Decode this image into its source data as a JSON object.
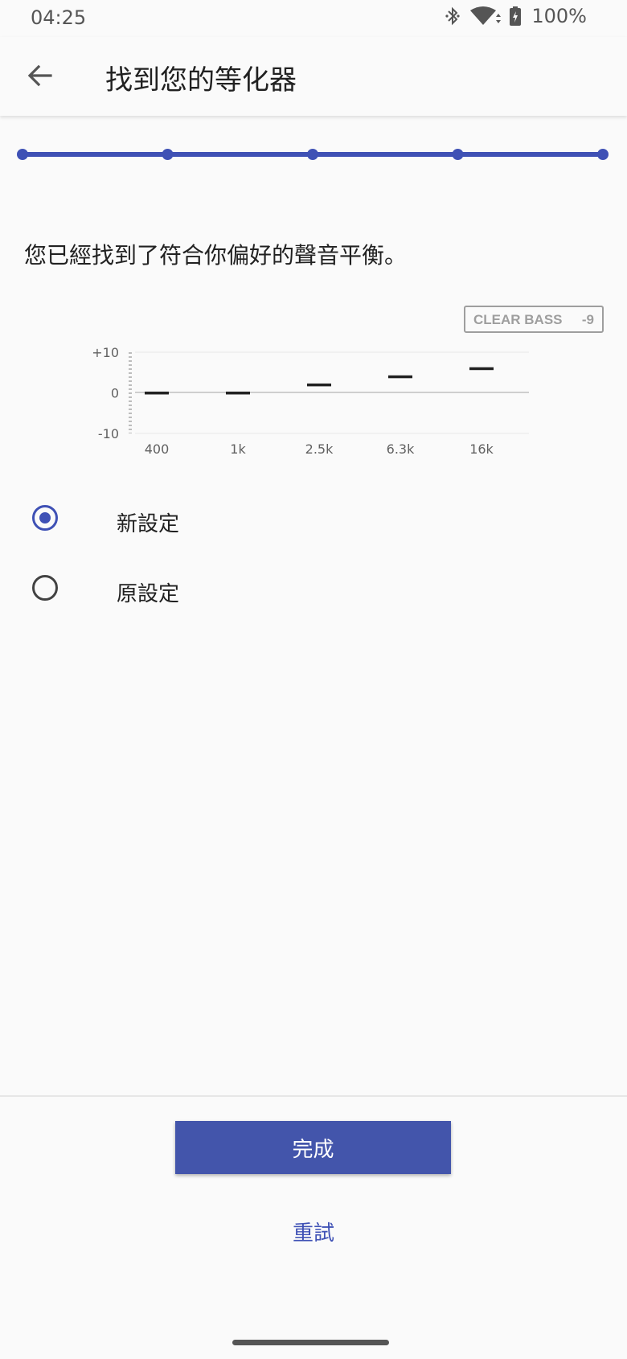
{
  "status_bar": {
    "time": "04:25",
    "battery": "100%",
    "icons": [
      "bluetooth-icon",
      "wifi-icon",
      "battery-charging-icon"
    ]
  },
  "app_bar": {
    "title": "找到您的等化器",
    "back_icon": "arrow-back-icon"
  },
  "progress": {
    "total_steps": 5,
    "completed_steps": 5,
    "accent": "#3f51b5"
  },
  "message": "您已經找到了符合你偏好的聲音平衡。",
  "clear_bass": {
    "label": "CLEAR BASS",
    "value": "-9"
  },
  "eq_chart": {
    "y_ticks": [
      "+10",
      "0",
      "-10"
    ],
    "ylim": [
      -10,
      10
    ],
    "bands": [
      "400",
      "1k",
      "2.5k",
      "6.3k",
      "16k"
    ],
    "values": [
      0,
      0,
      2,
      4,
      6
    ]
  },
  "options": [
    {
      "label": "新設定",
      "selected": true
    },
    {
      "label": "原設定",
      "selected": false
    }
  ],
  "actions": {
    "done_label": "完成",
    "retry_label": "重試"
  },
  "colors": {
    "accent": "#3f51b5",
    "button": "#4355ab"
  }
}
